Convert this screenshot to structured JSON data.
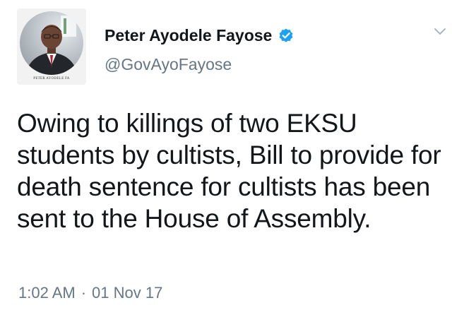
{
  "author": {
    "display_name": "Peter Ayodele Fayose",
    "handle": "@GovAyoFayose",
    "verified": true,
    "avatar_caption": "PETER AYODELE FA"
  },
  "tweet": {
    "text": "Owing to killings of two EKSU students by cultists, Bill to provide for death sentence for cultists has been sent to the House of Assembly.",
    "time": "1:02 AM",
    "separator": "·",
    "date": "01 Nov 17"
  },
  "icons": {
    "verified": "verified-badge-icon",
    "menu": "chevron-down-icon"
  },
  "colors": {
    "verified_blue": "#1da1f2",
    "name": "#14171a",
    "secondary": "#657786"
  }
}
